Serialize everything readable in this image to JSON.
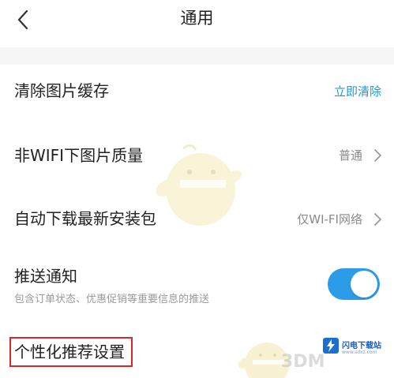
{
  "header": {
    "title": "通用",
    "back_icon": "chevron-left-icon"
  },
  "settings": {
    "clear_cache": {
      "label": "清除图片缓存",
      "action": "立即清除"
    },
    "non_wifi_quality": {
      "label": "非WIFI下图片质量",
      "value": "普通"
    },
    "auto_download": {
      "label": "自动下载最新安装包",
      "value": "仅WI-FI网络"
    },
    "push": {
      "label": "推送通知",
      "description": "包含订单状态、优惠促销等重要信息的推送",
      "enabled": true
    },
    "personalized": {
      "label": "个性化推荐设置"
    }
  },
  "watermark": {
    "brand": "3DM",
    "site_name": "闪电下载站",
    "site_url": "www.sdxz.com"
  },
  "colors": {
    "accent": "#1a9bd8",
    "toggle_on": "#2c9be8",
    "highlight": "#d8262a",
    "secondary_text": "#8a8a8a",
    "divider_bg": "#f6f6f6"
  }
}
